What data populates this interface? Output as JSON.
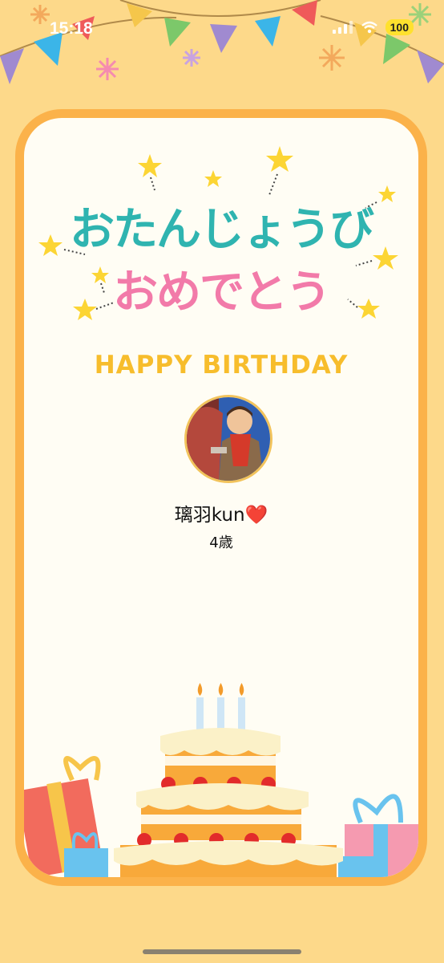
{
  "status_bar": {
    "time": "15:18",
    "battery": "100"
  },
  "card": {
    "title_line1": "おたんじょうび",
    "title_line2": "おめでとう",
    "subtitle": "HAPPY BIRTHDAY",
    "name": "璃羽kun❤️",
    "age": "4歳"
  }
}
